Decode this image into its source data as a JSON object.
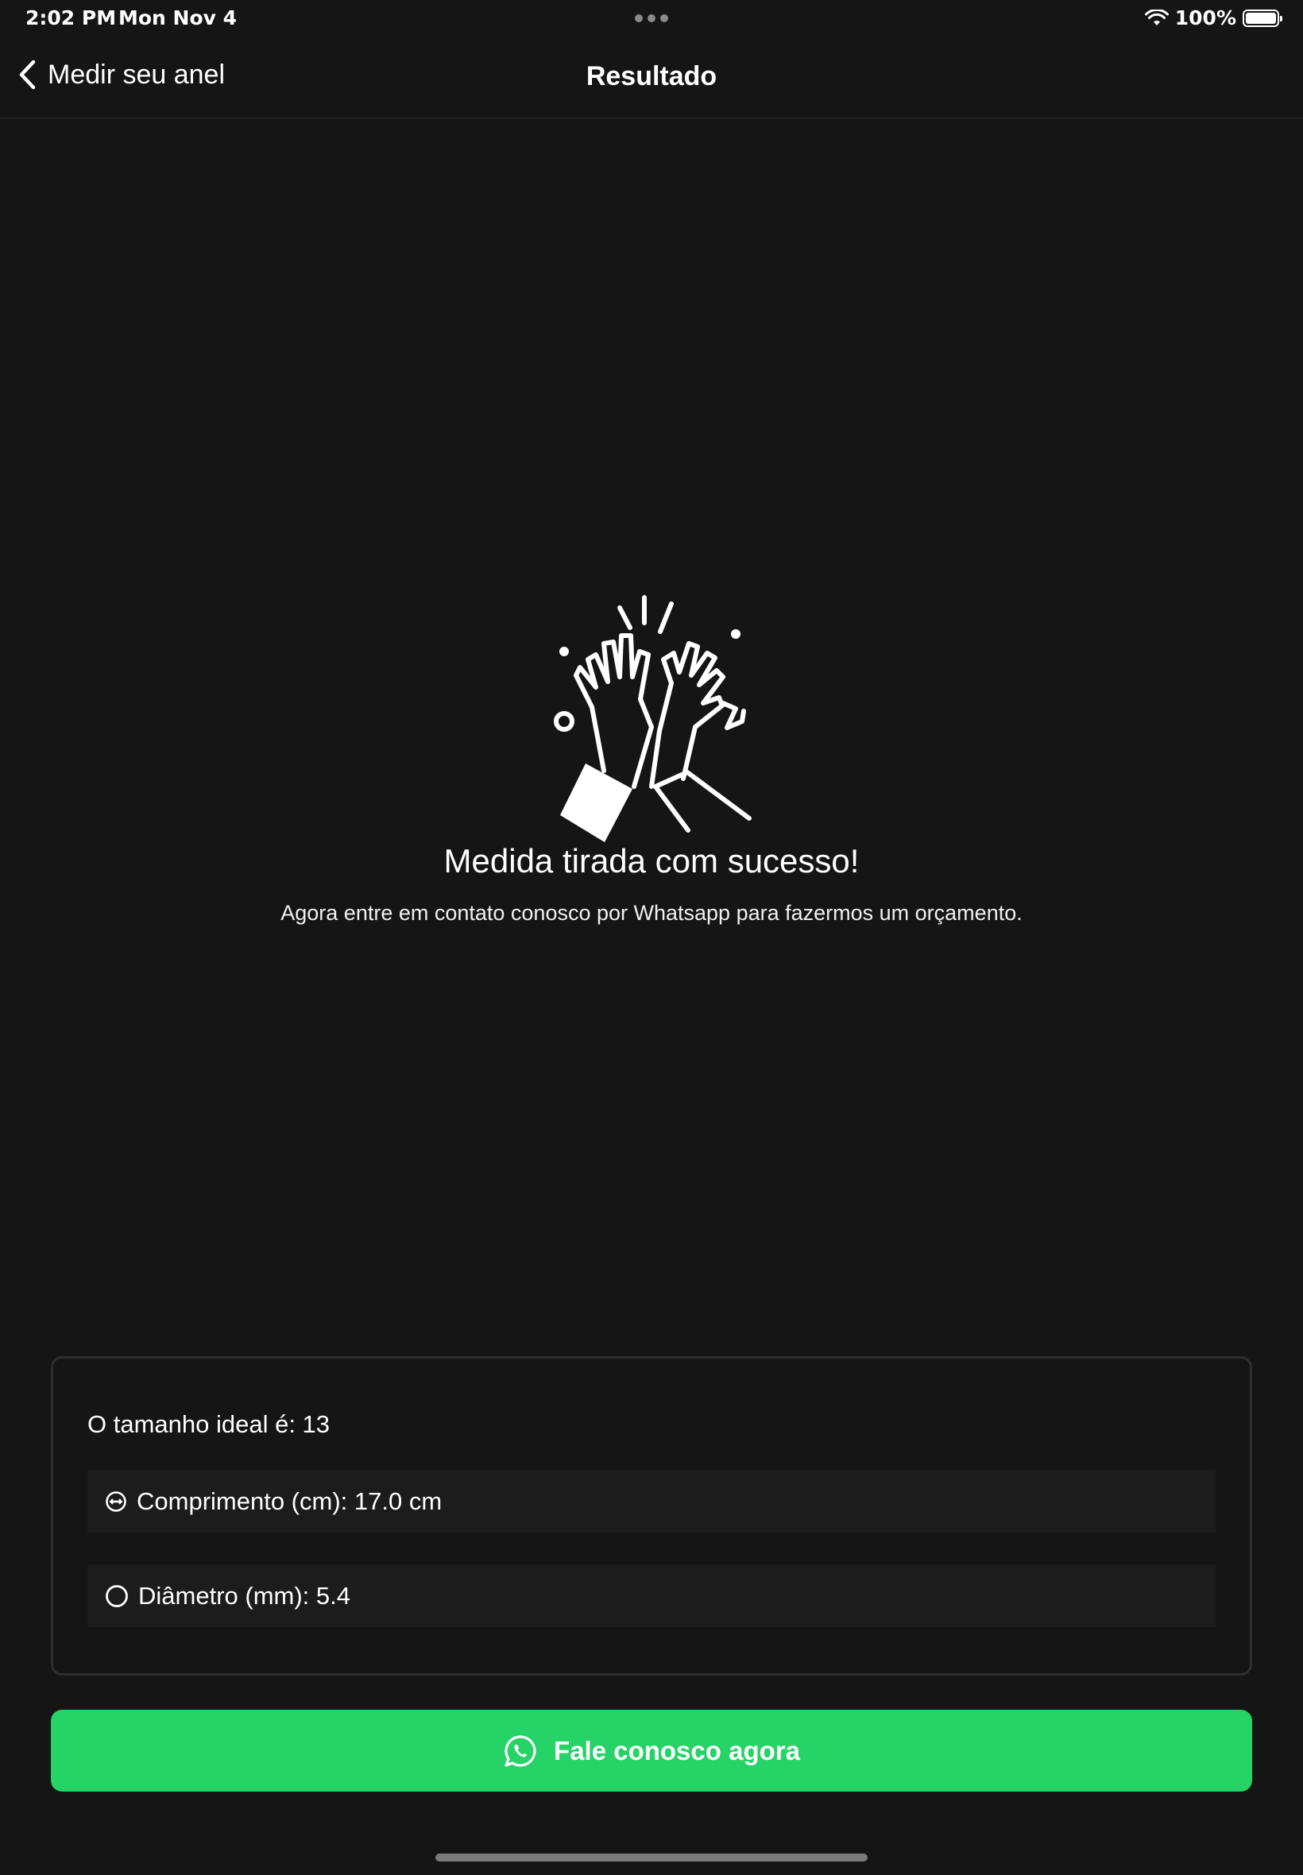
{
  "status_bar": {
    "time": "2:02 PM",
    "date": "Mon Nov 4",
    "battery_percent": "100%",
    "battery_level": 1.0,
    "icons": [
      "wifi-icon",
      "battery-icon"
    ]
  },
  "nav": {
    "back_label": "Medir seu anel",
    "title": "Resultado",
    "back_icon": "chevron-left-icon"
  },
  "hero": {
    "illustration": "high-five-hands-icon",
    "headline": "Medida tirada com sucesso!",
    "subline": "Agora entre em contato conosco por Whatsapp para fazermos um orçamento."
  },
  "result": {
    "ideal_size_text": "O tamanho ideal é: 13",
    "length_text": "Comprimento (cm): 17.0 cm",
    "length_icon": "length-icon",
    "diameter_text": "Diâmetro (mm): 5.4",
    "diameter_icon": "circle-icon"
  },
  "cta": {
    "label": "Fale conosco agora",
    "icon": "whatsapp-icon",
    "color": "#25d366"
  },
  "colors": {
    "background": "#151515",
    "text": "#ffffff",
    "card_border": "#2e2e2e",
    "row_background": "#1c1c1c"
  }
}
